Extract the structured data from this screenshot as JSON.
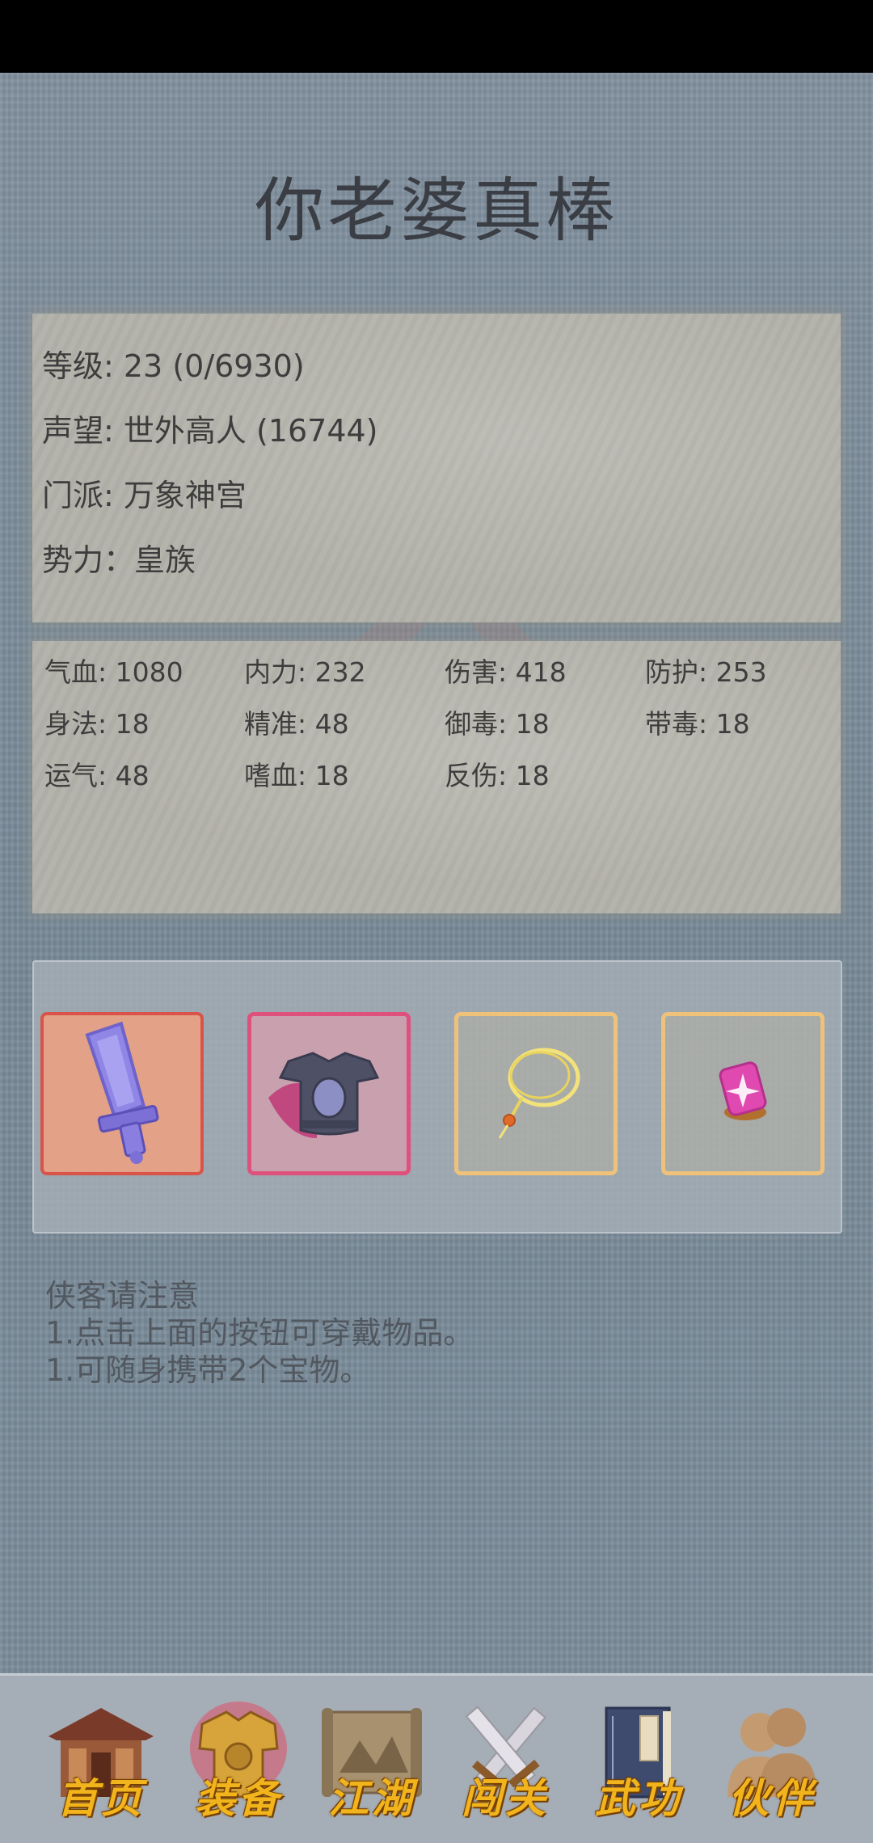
{
  "title": "你老婆真棒",
  "profile": {
    "level": "等级: 23 (0/6930)",
    "reputation": "声望: 世外高人 (16744)",
    "sect": "门派: 万象神宫",
    "faction": "势力：皇族"
  },
  "attributes": [
    "气血: 1080",
    "内力: 232",
    "伤害: 418",
    "防护: 253",
    "身法: 18",
    "精准: 48",
    "御毒: 18",
    "带毒: 18",
    "运气: 48",
    "嗜血: 18",
    "反伤: 18"
  ],
  "equipment": [
    {
      "icon": "sword-icon",
      "rarity_color": "#d9534a"
    },
    {
      "icon": "armor-icon",
      "rarity_color": "#e0507c"
    },
    {
      "icon": "necklace-icon",
      "rarity_color": "#efc27a"
    },
    {
      "icon": "gem-icon",
      "rarity_color": "#efc27a"
    }
  ],
  "notice": {
    "heading": "侠客请注意",
    "line1": "1.点击上面的按钮可穿戴物品。",
    "line2": "1.可随身携带2个宝物。"
  },
  "nav": [
    {
      "label": "首页",
      "icon": "house-icon"
    },
    {
      "label": "装备",
      "icon": "armor-icon",
      "active": true
    },
    {
      "label": "江湖",
      "icon": "scroll-map-icon"
    },
    {
      "label": "闯关",
      "icon": "crossed-swords-icon"
    },
    {
      "label": "武功",
      "icon": "book-icon"
    },
    {
      "label": "伙伴",
      "icon": "partners-icon"
    }
  ]
}
